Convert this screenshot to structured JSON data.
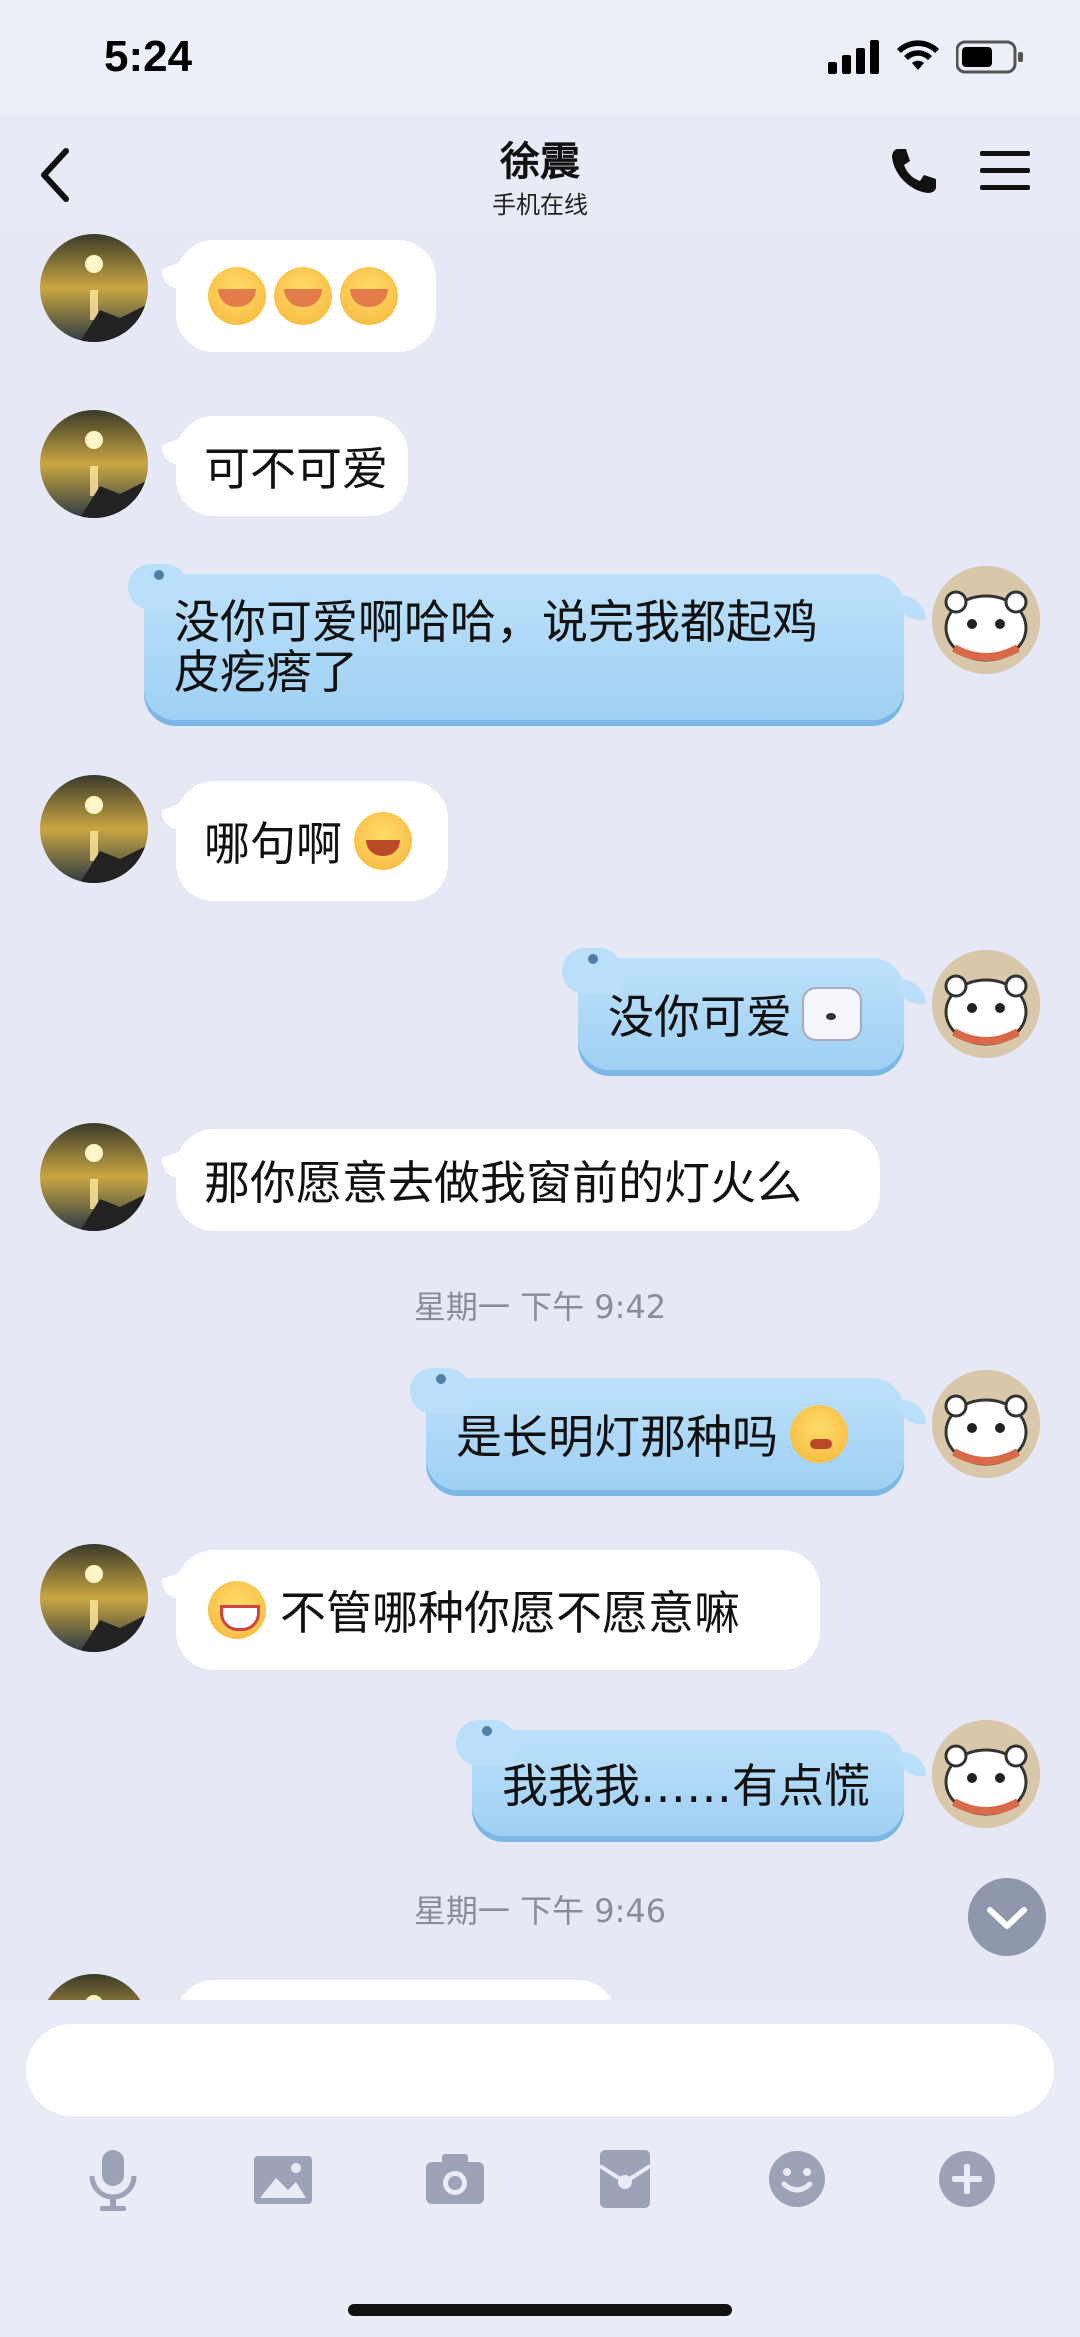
{
  "status": {
    "time": "5:24"
  },
  "header": {
    "title": "徐震",
    "subtitle": "手机在线"
  },
  "messages": [
    {
      "side": "left",
      "text": ""
    },
    {
      "side": "left",
      "text": "可不可爱"
    },
    {
      "side": "right",
      "line1": "没你可爱啊哈哈，说完我都起鸡",
      "line2": "皮疙瘩了"
    },
    {
      "side": "left",
      "text": "哪句啊"
    },
    {
      "side": "right",
      "text": "没你可爱"
    },
    {
      "side": "left",
      "text": "那你愿意去做我窗前的灯火么"
    },
    {
      "side": "right",
      "text": "是长明灯那种吗"
    },
    {
      "side": "left",
      "text": "不管哪种你愿不愿意嘛"
    },
    {
      "side": "right",
      "text": "我我我……有点慌"
    }
  ],
  "timestamps": [
    "星期一 下午 9:42",
    "星期一 下午 9:46"
  ],
  "colors": {
    "bubble_right": "#b9dffa",
    "bubble_left": "#ffffff",
    "icon": "#9ca2b8"
  },
  "toolbar_icons": [
    "mic-icon",
    "image-icon",
    "camera-icon",
    "red-packet-icon",
    "emoji-icon",
    "plus-icon"
  ]
}
